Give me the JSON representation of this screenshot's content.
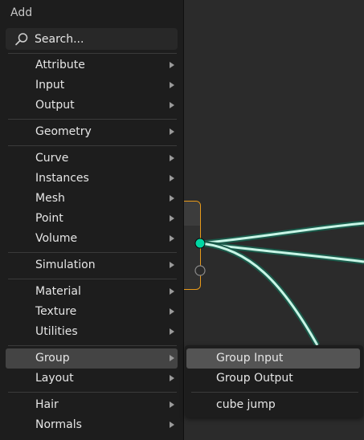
{
  "menu": {
    "title": "Add",
    "search_label": "Search...",
    "items": [
      {
        "label": "Attribute"
      },
      {
        "label": "Input"
      },
      {
        "label": "Output"
      },
      {
        "label": "Geometry"
      },
      {
        "label": "Curve"
      },
      {
        "label": "Instances"
      },
      {
        "label": "Mesh"
      },
      {
        "label": "Point"
      },
      {
        "label": "Volume"
      },
      {
        "label": "Simulation"
      },
      {
        "label": "Material"
      },
      {
        "label": "Texture"
      },
      {
        "label": "Utilities"
      },
      {
        "label": "Group"
      },
      {
        "label": "Layout"
      },
      {
        "label": "Hair"
      },
      {
        "label": "Normals"
      }
    ]
  },
  "submenu": {
    "items": [
      {
        "label": "Group Input"
      },
      {
        "label": "Group Output"
      },
      {
        "label": "cube jump"
      }
    ]
  },
  "colors": {
    "menu_bg": "#1d1d1d",
    "active_item": "#444444",
    "highlight_item": "#545454",
    "node_border": "#e89a1a",
    "socket_geometry": "#00d6a3",
    "link_glow": "#c8f5e6"
  }
}
